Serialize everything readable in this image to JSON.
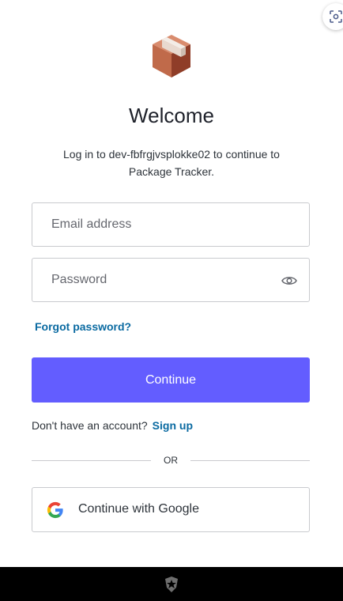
{
  "header": {
    "title": "Welcome",
    "subtitle_line1": "Log in to dev-fbfrgjvsplokke02 to continue to",
    "subtitle_line2": "Package Tracker."
  },
  "form": {
    "email_placeholder": "Email address",
    "email_value": "",
    "password_placeholder": "Password",
    "password_value": "",
    "forgot_password": "Forgot password?",
    "continue_label": "Continue"
  },
  "signup": {
    "prompt": "Don't have an account?",
    "link": "Sign up"
  },
  "divider": {
    "label": "OR"
  },
  "social": {
    "google_label": "Continue with Google"
  },
  "icons": {
    "scan": "screen-capture-icon",
    "logo": "package-box-icon",
    "eye": "show-password-eye-icon",
    "google": "google-logo-icon",
    "footer": "auth0-shield-icon"
  },
  "colors": {
    "primary": "#635dff",
    "link": "#0a6aa1",
    "text": "#2d333a",
    "border": "#c9cace",
    "footer_bg": "#000000"
  }
}
